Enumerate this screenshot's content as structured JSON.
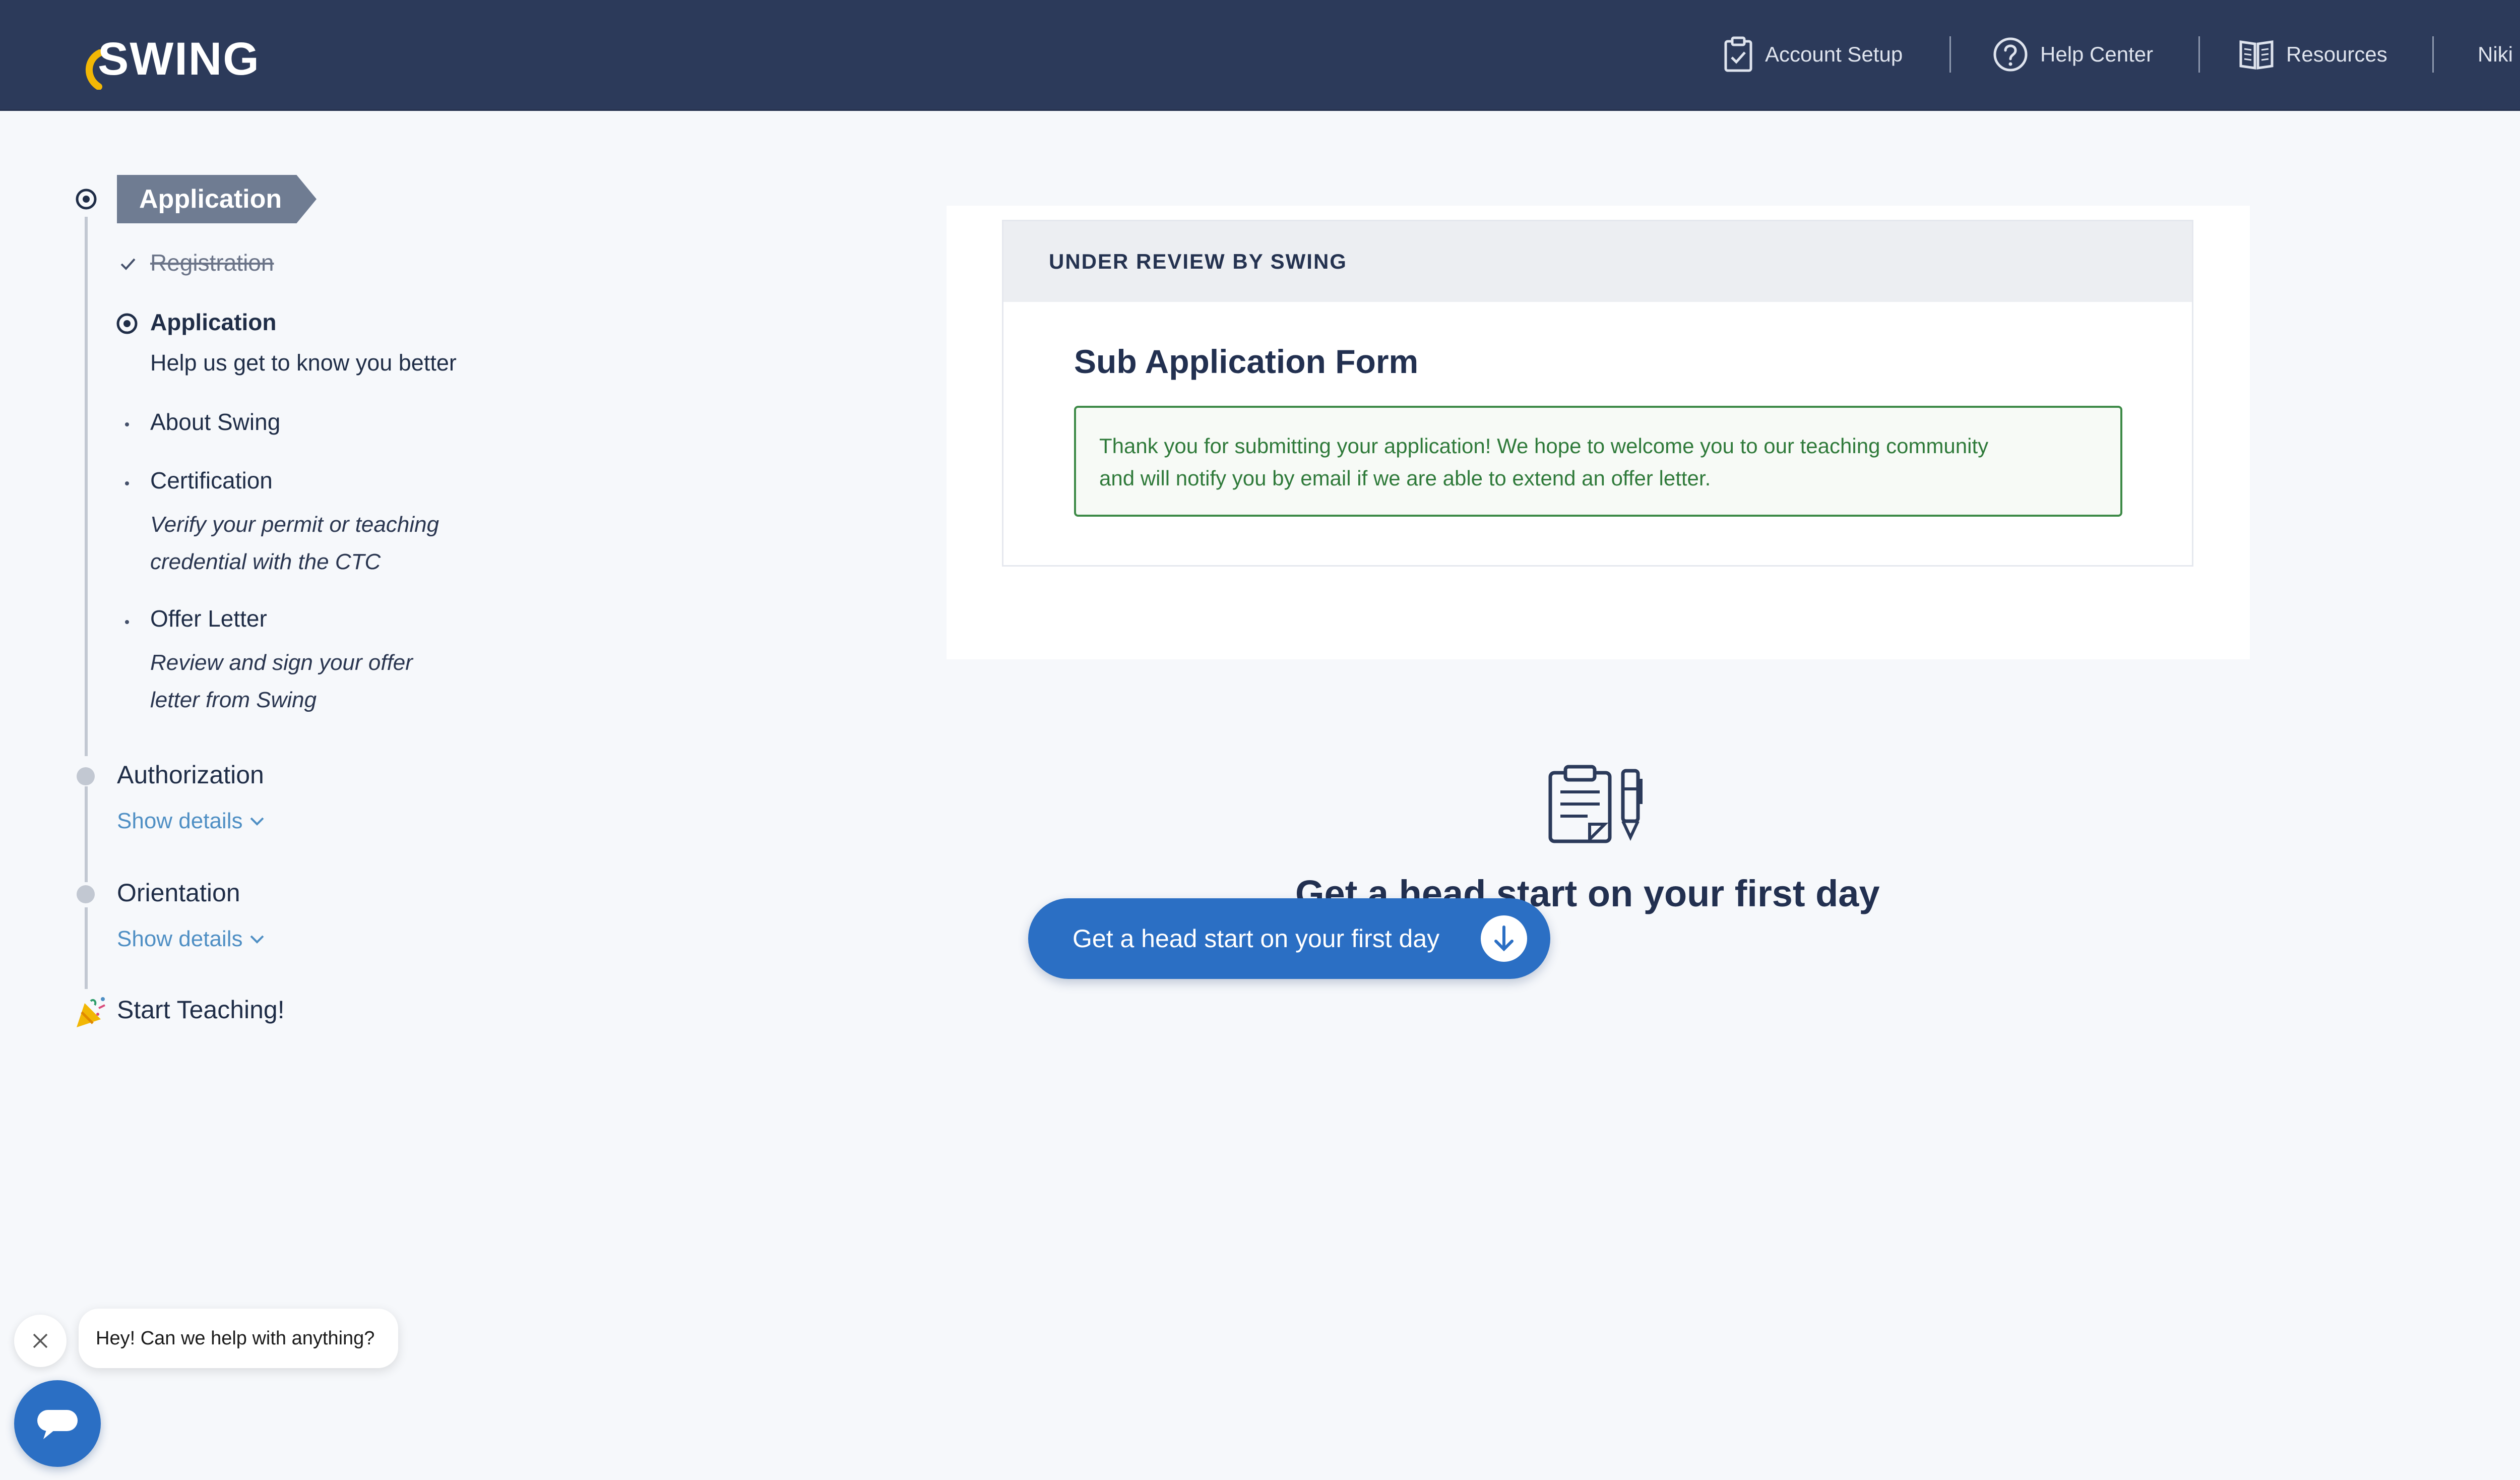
{
  "header": {
    "logo_text": "SWING",
    "nav": [
      {
        "label": "Account Setup",
        "icon": "clipboard-check-icon"
      },
      {
        "label": "Help Center",
        "icon": "question-circle-icon"
      },
      {
        "label": "Resources",
        "icon": "book-open-icon"
      }
    ],
    "user_name": "Niki"
  },
  "sidebar": {
    "current_stage": "Application",
    "steps": {
      "registration": "Registration",
      "application": "Application",
      "application_desc": "Help us get to know you better",
      "about_swing": "About Swing",
      "certification": "Certification",
      "certification_desc_1": "Verify your permit or teaching",
      "certification_desc_2": "credential with the CTC",
      "offer_letter": "Offer Letter",
      "offer_letter_desc_1": "Review and sign your offer",
      "offer_letter_desc_2": "letter from Swing"
    },
    "stages": {
      "authorization": "Authorization",
      "orientation": "Orientation",
      "start_teaching": "Start Teaching!"
    },
    "show_details": "Show details"
  },
  "card": {
    "status": "UNDER REVIEW BY SWING",
    "form_title": "Sub Application Form",
    "notice_line_1": "Thank you for submitting your application! We hope to welcome you to our teaching community",
    "notice_line_2": "and will notify you by email if we are able to extend an offer letter."
  },
  "lower": {
    "heading": "Get a head start on your first day",
    "cta_label": "Get a head start on your first day"
  },
  "chat": {
    "message": "Hey! Can we help with anything?"
  },
  "colors": {
    "header_bg": "#2c3a5a",
    "accent_blue": "#2b6fc4",
    "logo_accent": "#f2b705",
    "success_green": "#3d8a47",
    "link_blue": "#4f8fc4"
  }
}
